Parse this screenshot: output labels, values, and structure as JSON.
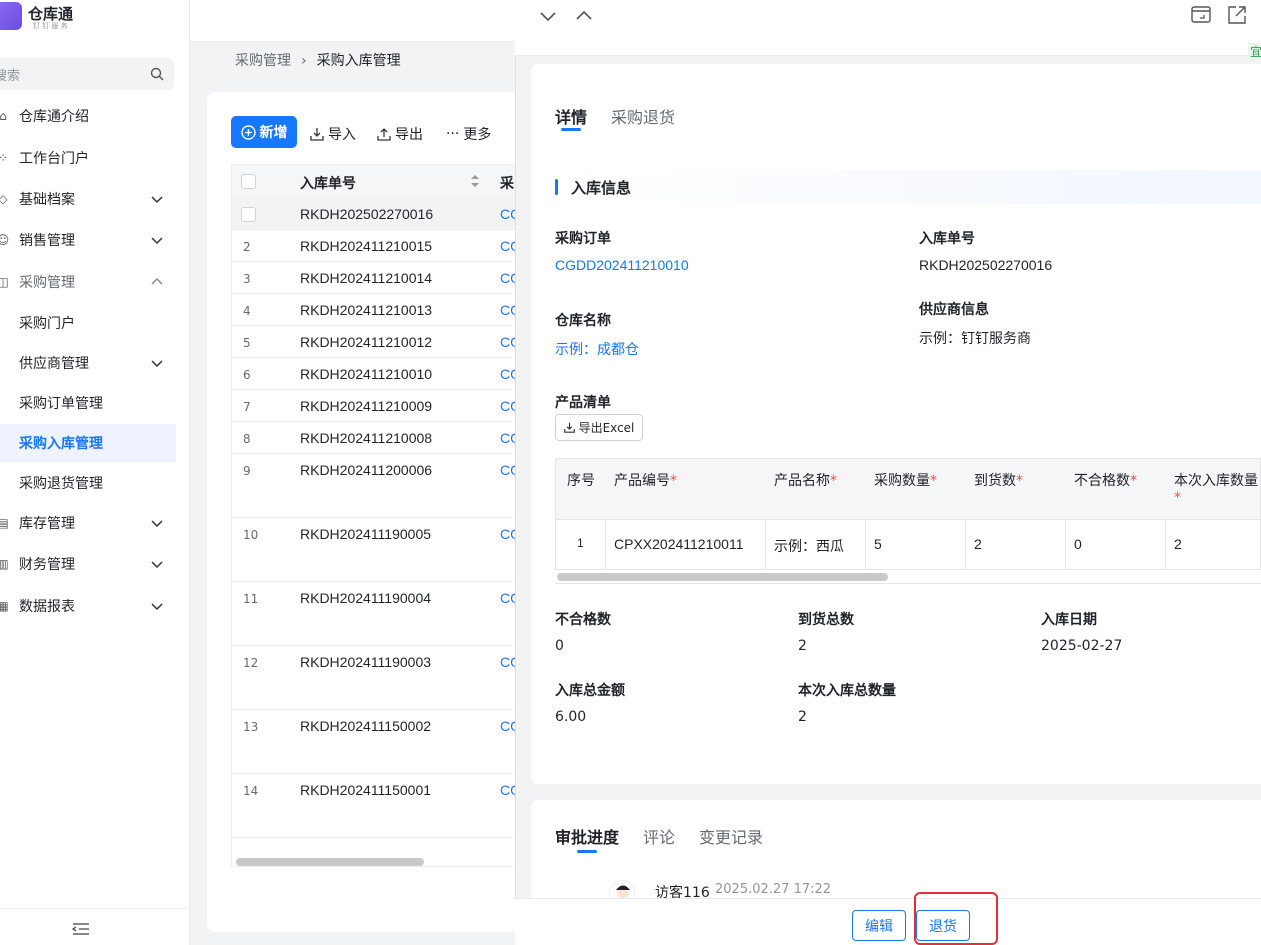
{
  "app": {
    "title": "仓库通",
    "subtitle": "钉 钉 服 务"
  },
  "sidebar": {
    "search_placeholder": "搜索",
    "items": [
      {
        "label": "仓库通介绍",
        "icon": "home-icon"
      },
      {
        "label": "工作台门户",
        "icon": "grid-icon"
      },
      {
        "label": "基础档案",
        "icon": "box-icon"
      },
      {
        "label": "销售管理",
        "icon": "user-icon"
      },
      {
        "label": "采购管理",
        "icon": "bag-icon"
      },
      {
        "label": "采购门户"
      },
      {
        "label": "供应商管理"
      },
      {
        "label": "采购订单管理"
      },
      {
        "label": "采购入库管理"
      },
      {
        "label": "采购退货管理"
      },
      {
        "label": "库存管理",
        "icon": "store-icon"
      },
      {
        "label": "财务管理",
        "icon": "chart-icon"
      },
      {
        "label": "数据报表",
        "icon": "report-icon"
      }
    ]
  },
  "breadcrumb": {
    "parent": "采购管理",
    "current": "采购入库管理"
  },
  "toolbar": {
    "new": "新增",
    "import": "导入",
    "export": "导出",
    "more": "更多"
  },
  "table": {
    "col_no": "入库单号",
    "col_po": "采",
    "rows": [
      {
        "idx": "",
        "no": "RKDH202502270016",
        "po": "CG"
      },
      {
        "idx": "2",
        "no": "RKDH202411210015",
        "po": "CG"
      },
      {
        "idx": "3",
        "no": "RKDH202411210014",
        "po": "CG"
      },
      {
        "idx": "4",
        "no": "RKDH202411210013",
        "po": "CG"
      },
      {
        "idx": "5",
        "no": "RKDH202411210012",
        "po": "CG"
      },
      {
        "idx": "6",
        "no": "RKDH202411210010",
        "po": "CG"
      },
      {
        "idx": "7",
        "no": "RKDH202411210009",
        "po": "CG"
      },
      {
        "idx": "8",
        "no": "RKDH202411210008",
        "po": "CG"
      },
      {
        "idx": "9",
        "no": "RKDH202411200006",
        "po": "CG"
      },
      {
        "idx": "10",
        "no": "RKDH202411190005",
        "po": "CG"
      },
      {
        "idx": "11",
        "no": "RKDH202411190004",
        "po": "CG"
      },
      {
        "idx": "12",
        "no": "RKDH202411190003",
        "po": "CG"
      },
      {
        "idx": "13",
        "no": "RKDH202411150002",
        "po": "CG"
      },
      {
        "idx": "14",
        "no": "RKDH202411150001",
        "po": "CG"
      }
    ]
  },
  "panel": {
    "side_tag": "宜",
    "tabs": [
      "详情",
      "采购退货"
    ],
    "section": "入库信息",
    "fields": {
      "po_label": "采购订单",
      "po_value": "CGDD202411210010",
      "in_no_label": "入库单号",
      "in_no_value": "RKDH202502270016",
      "wh_label": "仓库名称",
      "wh_value": "示例：成都仓",
      "sup_label": "供应商信息",
      "sup_value": "示例：钉钉服务商",
      "products_label": "产品清单",
      "export_excel": "导出Excel"
    },
    "product_table": {
      "headers": [
        "序号",
        "产品编号",
        "产品名称",
        "采购数量",
        "到货数",
        "不合格数",
        "本次入库数量"
      ],
      "row": [
        "1",
        "CPXX202411210011",
        "示例：西瓜",
        "5",
        "2",
        "0",
        "2"
      ]
    },
    "summary": {
      "bad_label": "不合格数",
      "bad_value": "0",
      "arr_label": "到货总数",
      "arr_value": "2",
      "date_label": "入库日期",
      "date_value": "2025-02-27",
      "amt_label": "入库总金额",
      "amt_value": "6.00",
      "qty_label": "本次入库总数量",
      "qty_value": "2"
    },
    "approval_tabs": [
      "审批进度",
      "评论",
      "变更记录"
    ],
    "approval": {
      "user": "访客116",
      "time": "2025.02.27 17:22"
    },
    "buttons": {
      "edit": "编辑",
      "return": "退货"
    }
  }
}
